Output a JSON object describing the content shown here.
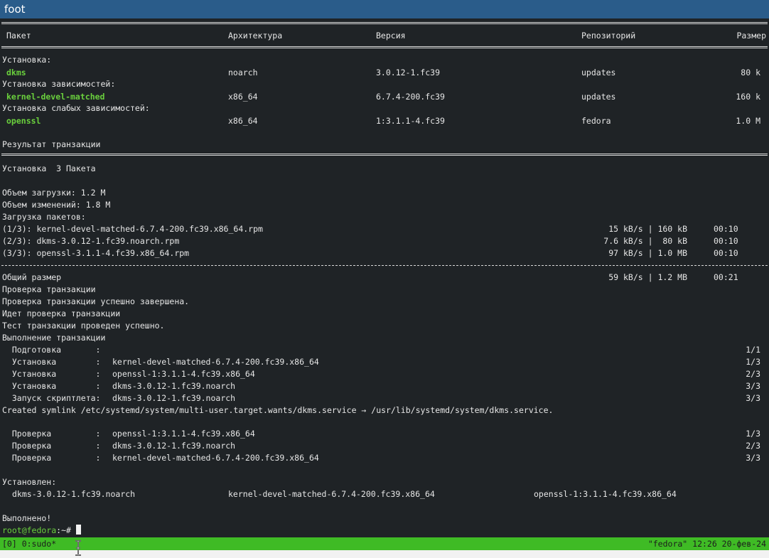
{
  "window": {
    "title": "foot"
  },
  "table": {
    "headers": {
      "package": "Пакет",
      "arch": "Архитектура",
      "version": "Версия",
      "repo": "Репозиторий",
      "size": "Размер"
    },
    "groups": [
      {
        "label": "Установка:",
        "row": {
          "name": "dkms",
          "arch": "noarch",
          "version": "3.0.12-1.fc39",
          "repo": "updates",
          "size": "80 k"
        }
      },
      {
        "label": "Установка зависимостей:",
        "row": {
          "name": "kernel-devel-matched",
          "arch": "x86_64",
          "version": "6.7.4-200.fc39",
          "repo": "updates",
          "size": "160 k"
        }
      },
      {
        "label": "Установка слабых зависимостей:",
        "row": {
          "name": "openssl",
          "arch": "x86_64",
          "version": "1:3.1.1-4.fc39",
          "repo": "fedora",
          "size": "1.0 M"
        }
      }
    ]
  },
  "summary": {
    "title": "Результат транзакции",
    "install_count": "Установка  3 Пакета",
    "download_size": "Объем загрузки: 1.2 M",
    "installed_size": "Объем изменений: 1.8 M",
    "downloading": "Загрузка пакетов:"
  },
  "downloads": [
    {
      "file": "(1/3): kernel-devel-matched-6.7.4-200.fc39.x86_64.rpm",
      "speed": "15 kB/s | 160 kB",
      "time": "00:10"
    },
    {
      "file": "(2/3): dkms-3.0.12-1.fc39.noarch.rpm",
      "speed": "7.6 kB/s |  80 kB",
      "time": "00:10"
    },
    {
      "file": "(3/3): openssl-3.1.1-4.fc39.x86_64.rpm",
      "speed": "97 kB/s | 1.0 MB",
      "time": "00:10"
    }
  ],
  "total": {
    "label": "Общий размер",
    "speed": "59 kB/s | 1.2 MB",
    "time": "00:21"
  },
  "transaction_lines": [
    "Проверка транзакции",
    "Проверка транзакции успешно завершена.",
    "Идет проверка транзакции",
    "Тест транзакции проведен успешно.",
    "Выполнение транзакции"
  ],
  "steps": [
    {
      "action": "  Подготовка       :",
      "item": "",
      "progress": "1/1"
    },
    {
      "action": "  Установка        :",
      "item": "kernel-devel-matched-6.7.4-200.fc39.x86_64",
      "progress": "1/3"
    },
    {
      "action": "  Установка        :",
      "item": "openssl-1:3.1.1-4.fc39.x86_64",
      "progress": "2/3"
    },
    {
      "action": "  Установка        :",
      "item": "dkms-3.0.12-1.fc39.noarch",
      "progress": "3/3"
    },
    {
      "action": "  Запуск скриптлета:",
      "item": "dkms-3.0.12-1.fc39.noarch",
      "progress": "3/3"
    }
  ],
  "symlink": "Created symlink /etc/systemd/system/multi-user.target.wants/dkms.service → /usr/lib/systemd/system/dkms.service.",
  "verify": [
    {
      "action": "  Проверка         :",
      "item": "openssl-1:3.1.1-4.fc39.x86_64",
      "progress": "1/3"
    },
    {
      "action": "  Проверка         :",
      "item": "dkms-3.0.12-1.fc39.noarch",
      "progress": "2/3"
    },
    {
      "action": "  Проверка         :",
      "item": "kernel-devel-matched-6.7.4-200.fc39.x86_64",
      "progress": "3/3"
    }
  ],
  "installed": {
    "label": "Установлен:",
    "items": [
      "dkms-3.0.12-1.fc39.noarch",
      "kernel-devel-matched-6.7.4-200.fc39.x86_64",
      "openssl-1:3.1.1-4.fc39.x86_64"
    ]
  },
  "done": "Выполнено!",
  "prompt": {
    "user": "root@fedora",
    "suffix": ":~# "
  },
  "tmux": {
    "left": "[0] 0:sudo*",
    "right": "\"fedora\" 12:26 20-фев-24"
  },
  "colors": {
    "title_bar": "#2a5c8a",
    "terminal_bg": "#1f2326",
    "package_green": "#6ad03d",
    "status_green": "#3fbb25"
  }
}
